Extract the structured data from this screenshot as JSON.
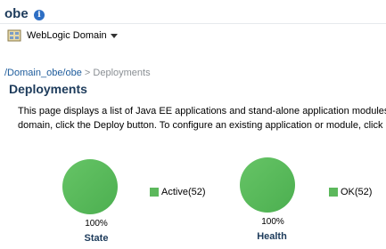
{
  "header": {
    "title": "obe",
    "info_icon": "info-icon",
    "domain_menu": {
      "label": "WebLogic Domain",
      "icon": "domain-icon"
    }
  },
  "breadcrumb": {
    "items": [
      "/Domain_obe/obe",
      " > ",
      "Deployments"
    ]
  },
  "section": {
    "title": "Deployments",
    "description_line1": "This page displays a list of Java EE applications and stand-alone application modules",
    "description_line2": "domain, click the Deploy button. To configure an existing application or module, click o"
  },
  "charts": {
    "state": {
      "caption": "State",
      "percent_label": "100%",
      "legend": "Active(52)",
      "color": "#5cb85c"
    },
    "health": {
      "caption": "Health",
      "percent_label": "100%",
      "legend": "OK(52)",
      "color": "#5cb85c"
    }
  },
  "chart_data": [
    {
      "type": "pie",
      "title": "State",
      "categories": [
        "Active"
      ],
      "values": [
        52
      ],
      "legend_entries": [
        "Active(52)"
      ],
      "slice_labels": [
        "100%"
      ]
    },
    {
      "type": "pie",
      "title": "Health",
      "categories": [
        "OK"
      ],
      "values": [
        52
      ],
      "legend_entries": [
        "OK(52)"
      ],
      "slice_labels": [
        "100%"
      ]
    }
  ]
}
